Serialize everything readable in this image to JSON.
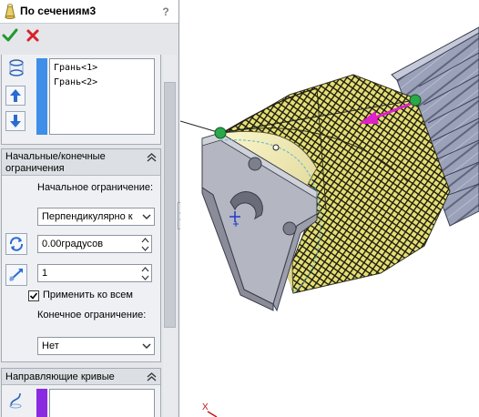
{
  "titlebar": {
    "title": "По сечениям3",
    "help_label": "?"
  },
  "actions": {
    "ok_icon": "checkmark-icon",
    "cancel_icon": "x-icon"
  },
  "profiles": {
    "items": [
      "Грань<1>",
      "Грань<2>"
    ]
  },
  "constraints": {
    "title": "Начальные/конечные ограничения",
    "start_label": "Начальное ограничение:",
    "start_value": "Перпендикулярно к",
    "angle_value": "0.00градусов",
    "tangent_value": "1",
    "apply_all_label": "Применить ко всем",
    "apply_all_checked": true,
    "end_label": "Конечное ограничение:",
    "end_value": "Нет"
  },
  "guides": {
    "title": "Направляющие кривые"
  },
  "colors": {
    "profile_bar": "#3f8ee8",
    "guide_bar": "#8a2be2",
    "preview_mesh": "#e8e27a",
    "arrow": "#e020c8",
    "handle": "#2aa84a"
  },
  "triad": {
    "x_label": "X"
  }
}
